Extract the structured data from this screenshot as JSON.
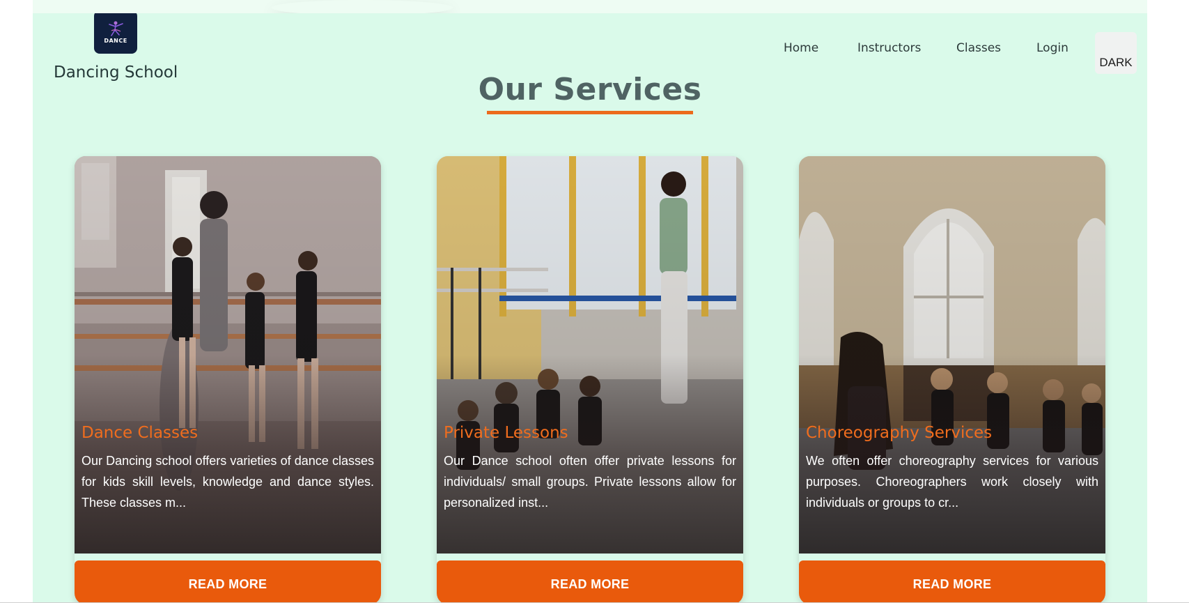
{
  "brand": {
    "logo_text": "DANCE",
    "name": "Dancing School"
  },
  "nav": {
    "home": "Home",
    "instructors": "Instructors",
    "classes": "Classes",
    "login": "Login",
    "theme_toggle": "DARK"
  },
  "section": {
    "title": "Our Services"
  },
  "cards": [
    {
      "title": "Dance Classes",
      "description": "Our Dancing school offers varieties of dance classes for kids skill levels, knowledge and dance styles. These classes m...",
      "button": "READ MORE"
    },
    {
      "title": "Private Lessons",
      "description": "Our Dance school often offer private lessons for individuals/ small groups. Private lessons allow for personalized inst...",
      "button": "READ MORE"
    },
    {
      "title": "Choreography Services",
      "description": "We often offer choreography services for various purposes. Choreographers work closely with individuals or groups to cr...",
      "button": "READ MORE"
    }
  ],
  "colors": {
    "background": "#dafaea",
    "accent": "#e95a0c",
    "title_text": "#4f6363",
    "card_title": "#f06d1e",
    "logo_bg": "#10203e"
  }
}
